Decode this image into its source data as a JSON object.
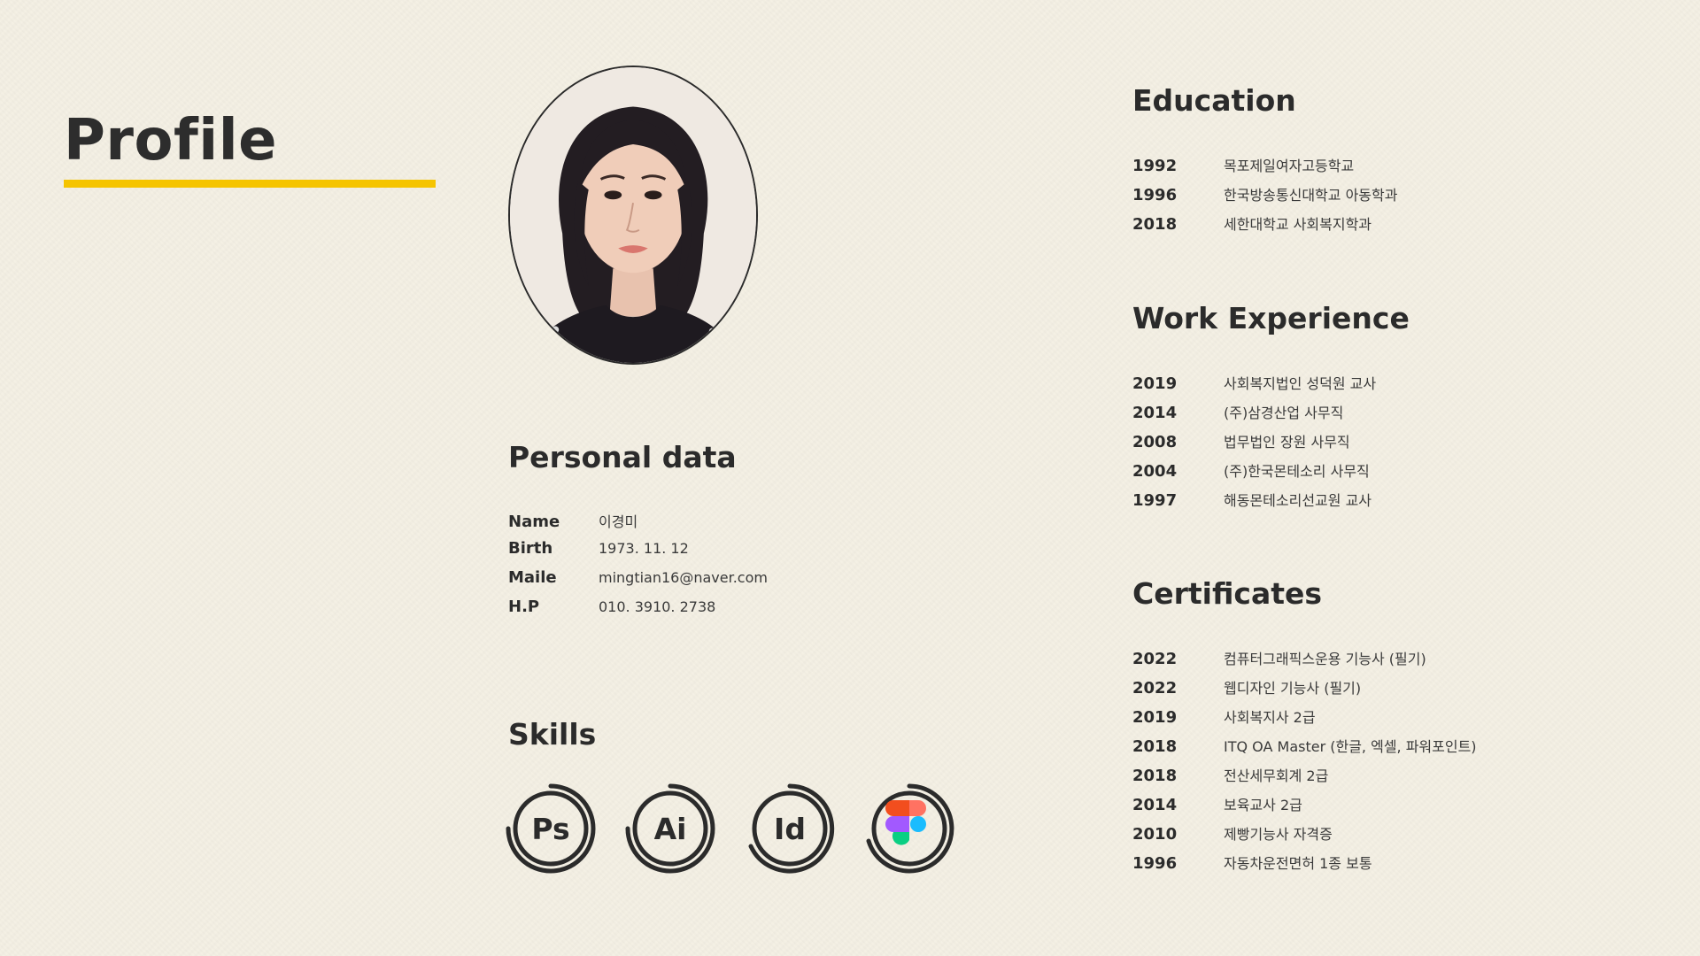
{
  "header": {
    "title": "Profile"
  },
  "personal": {
    "heading": "Personal data",
    "rows": [
      {
        "label": "Name",
        "value": "이경미"
      },
      {
        "label": "Birth",
        "value": "1973. 11. 12"
      },
      {
        "label": "Maile",
        "value": "mingtian16@naver.com"
      },
      {
        "label": "H.P",
        "value": "010. 3910. 2738"
      }
    ]
  },
  "skills": {
    "heading": "Skills",
    "items": [
      {
        "label": "Ps",
        "icon": "photoshop-icon"
      },
      {
        "label": "Ai",
        "icon": "illustrator-icon"
      },
      {
        "label": "Id",
        "icon": "indesign-icon"
      },
      {
        "label": "",
        "icon": "figma-icon"
      }
    ]
  },
  "education": {
    "heading": "Education",
    "items": [
      {
        "year": "1992",
        "text": "목포제일여자고등학교"
      },
      {
        "year": "1996",
        "text": "한국방송통신대학교 아동학과"
      },
      {
        "year": "2018",
        "text": "세한대학교 사회복지학과"
      }
    ]
  },
  "work": {
    "heading": "Work Experience",
    "items": [
      {
        "year": "2019",
        "text": "사회복지법인 성덕원 교사"
      },
      {
        "year": "2014",
        "text": "(주)삼경산업 사무직"
      },
      {
        "year": "2008",
        "text": "법무법인 장원 사무직"
      },
      {
        "year": "2004",
        "text": "(주)한국몬테소리 사무직"
      },
      {
        "year": "1997",
        "text": "해동몬테소리선교원 교사"
      }
    ]
  },
  "certificates": {
    "heading": "Certificates",
    "items": [
      {
        "year": "2022",
        "text": "컴퓨터그래픽스운용 기능사 (필기)"
      },
      {
        "year": "2022",
        "text": "웹디자인 기능사 (필기)"
      },
      {
        "year": "2019",
        "text": "사회복지사 2급"
      },
      {
        "year": "2018",
        "text": "ITQ OA Master (한글, 엑셀, 파워포인트)"
      },
      {
        "year": "2018",
        "text": "전산세무회계 2급"
      },
      {
        "year": "2014",
        "text": "보육교사 2급"
      },
      {
        "year": "2010",
        "text": "제빵기능사 자격증"
      },
      {
        "year": "1996",
        "text": "자동차운전면허 1종 보통"
      }
    ]
  },
  "colors": {
    "accent": "#f5c400",
    "text": "#2b2b2b",
    "background": "#f4f0e4"
  }
}
